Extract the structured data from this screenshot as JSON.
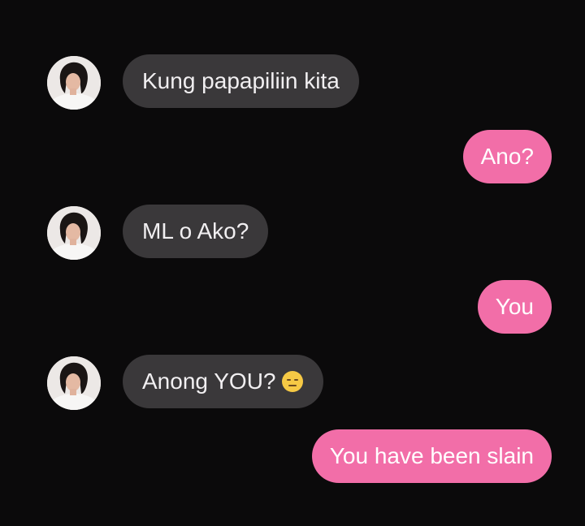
{
  "messages": [
    {
      "direction": "incoming",
      "text": "Kung papapiliin kita",
      "sender_avatar": "avatar"
    },
    {
      "direction": "outgoing",
      "text": "Ano?"
    },
    {
      "direction": "incoming",
      "text": "ML o Ako?",
      "sender_avatar": "avatar"
    },
    {
      "direction": "outgoing",
      "text": "You"
    },
    {
      "direction": "incoming",
      "text": "Anong YOU?",
      "sender_avatar": "avatar",
      "emoji": "expressionless-face-emoji"
    },
    {
      "direction": "outgoing",
      "text": "You have been slain"
    }
  ],
  "colors": {
    "background": "#0b0a0b",
    "incoming_bubble": "#3a383a",
    "incoming_text": "#f1eff1",
    "outgoing_bubble": "#f26ea8",
    "outgoing_text": "#ffffff"
  }
}
